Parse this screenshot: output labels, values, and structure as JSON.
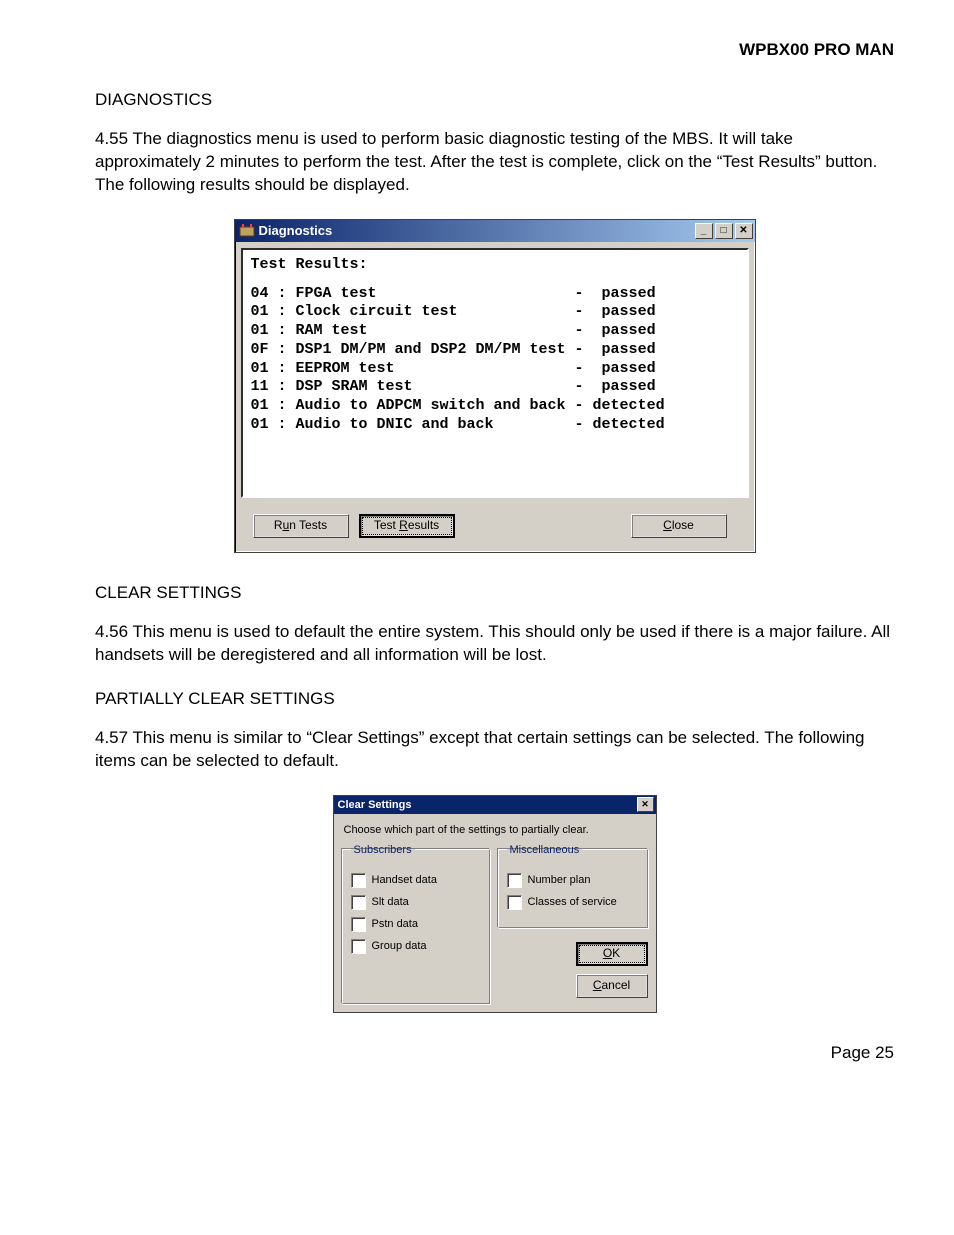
{
  "doc": {
    "header": "WPBX00 PRO MAN",
    "page_label": "Page 25",
    "sections": {
      "diag_heading": "DIAGNOSTICS",
      "diag_para": "4.55    The diagnostics menu is used to perform basic diagnostic testing of the MBS.  It will take approximately 2 minutes to perform the test.  After the test is complete, click on the “Test Results” button.  The following results should be displayed.",
      "clear_heading": "CLEAR SETTINGS",
      "clear_para": "4.56    This menu is used to default the entire system.  This should only be used if there is a major failure.  All handsets will be deregistered and all information will be lost.",
      "partial_heading": "PARTIALLY CLEAR SETTINGS",
      "partial_para": "4.57    This menu is  similar to “Clear Settings” except that certain settings can be selected.  The following items can be selected to default."
    }
  },
  "diag_window": {
    "title": "Diagnostics",
    "results_title": "Test Results:",
    "results_lines": [
      "04 : FPGA test                      -  passed",
      "01 : Clock circuit test             -  passed",
      "01 : RAM test                       -  passed",
      "0F : DSP1 DM/PM and DSP2 DM/PM test -  passed",
      "01 : EEPROM test                    -  passed",
      "11 : DSP SRAM test                  -  passed",
      "01 : Audio to ADPCM switch and back - detected",
      "01 : Audio to DNIC and back         - detected"
    ],
    "buttons": {
      "run": "Run Tests",
      "results_pre": "Test ",
      "results_ul": "R",
      "results_post": "esults",
      "close_ul": "C",
      "close_post": "lose"
    },
    "win_controls": {
      "minimize": "_",
      "maximize": "□",
      "close": "✕"
    }
  },
  "clear_window": {
    "title": "Clear Settings",
    "close": "✕",
    "instruction": "Choose which part of the settings to partially clear.",
    "groups": {
      "subs": {
        "legend": "Subscribers",
        "items": [
          "Handset data",
          "Slt data",
          "Pstn data",
          "Group data"
        ]
      },
      "misc": {
        "legend": "Miscellaneous",
        "items": [
          "Number plan",
          "Classes of service"
        ]
      }
    },
    "buttons": {
      "ok_ul": "O",
      "ok_post": "K",
      "cancel_ul": "C",
      "cancel_post": "ancel"
    }
  }
}
